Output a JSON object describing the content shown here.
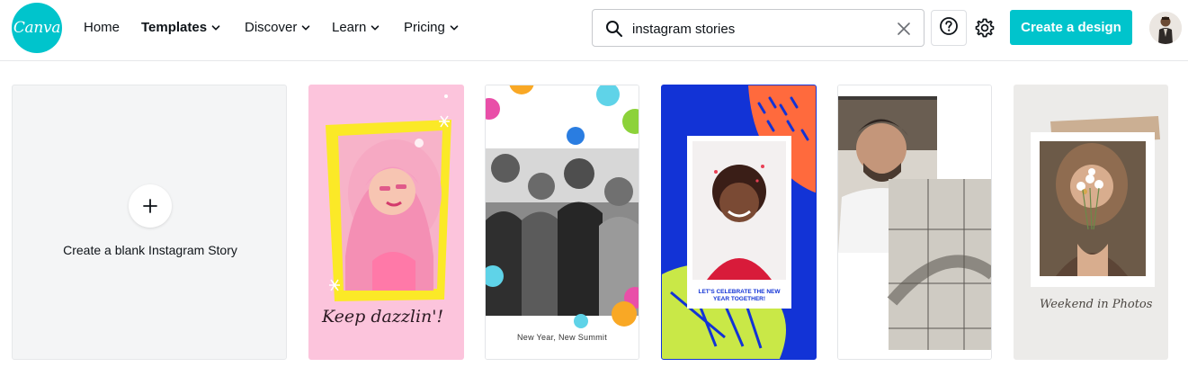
{
  "header": {
    "logo_text": "Canva",
    "nav": [
      {
        "label": "Home"
      },
      {
        "label": "Templates"
      },
      {
        "label": "Discover"
      },
      {
        "label": "Learn"
      },
      {
        "label": "Pricing"
      }
    ],
    "search": {
      "value": "instagram stories",
      "icon": "search-icon",
      "clear_icon": "close-icon"
    },
    "help_icon": "help-circle-icon",
    "settings_icon": "gear-icon",
    "create_button": "Create a design",
    "brand_color": "#00c4cc"
  },
  "cards": {
    "blank_label": "Create a blank Instagram Story",
    "templates": [
      {
        "text": "Keep dazzlin'!"
      },
      {
        "text": "New Year, New Summit"
      },
      {
        "text": "LET'S CELEBRATE THE NEW YEAR TOGETHER!"
      },
      {
        "text": ""
      },
      {
        "text": "Weekend in Photos"
      }
    ]
  }
}
